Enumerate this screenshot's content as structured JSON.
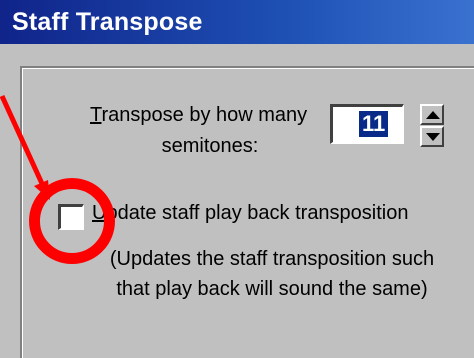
{
  "window": {
    "title": "Staff Transpose"
  },
  "transpose": {
    "label_line1_access": "T",
    "label_line1_rest": "ranspose by how many",
    "label_line2": "semitones:",
    "value": "11"
  },
  "update_option": {
    "label_access": "U",
    "label_rest": "pdate staff play back transposition",
    "checked": false,
    "description_line1": "(Updates the staff transposition such",
    "description_line2": "that play back will sound the same)"
  },
  "annotation": {
    "color": "#ff0000"
  },
  "icons": {
    "spin_up": "spin-up-arrow-icon",
    "spin_down": "spin-down-arrow-icon"
  }
}
